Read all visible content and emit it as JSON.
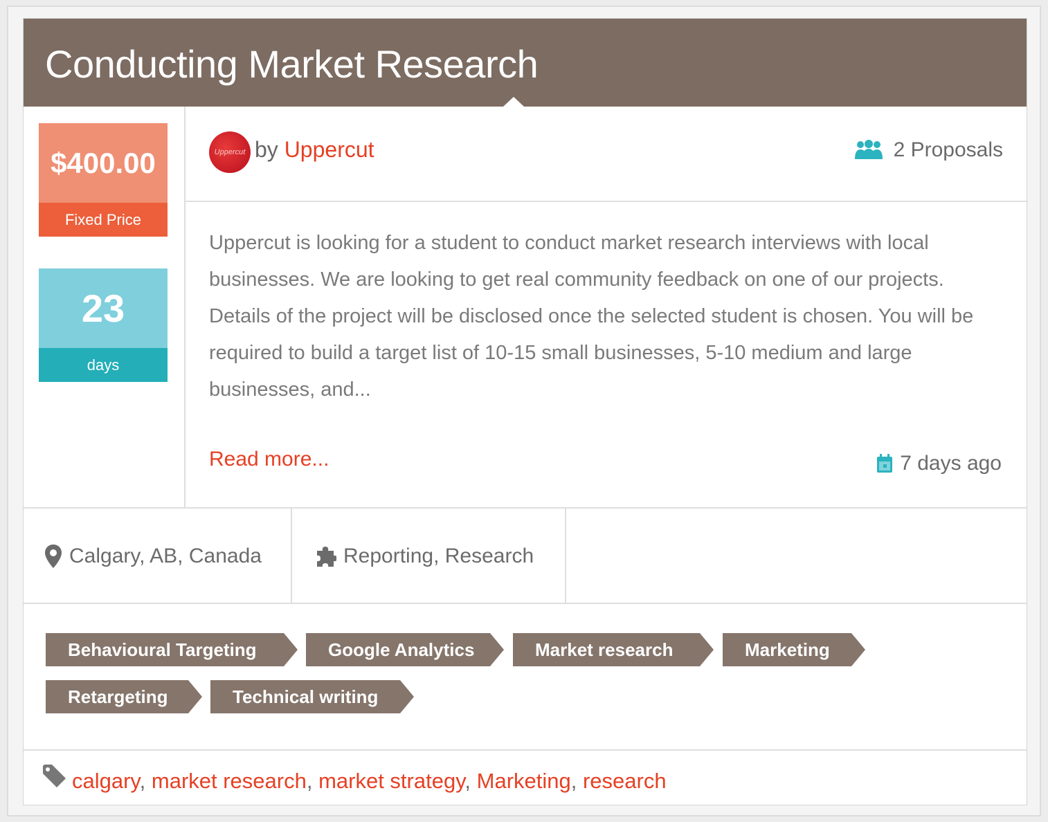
{
  "job": {
    "title": "Conducting Market Research",
    "price": "$400.00",
    "price_type": "Fixed Price",
    "days": "23",
    "days_label": "days",
    "author_prefix": "by ",
    "author_name": "Uppercut",
    "avatar_text": "Uppercut",
    "proposals": "2 Proposals",
    "description": "Uppercut is looking for a student to conduct market research interviews with local businesses. We are looking to get real community feedback on one of our projects. Details of the project will be disclosed once the selected student is chosen. You will be required to build a target list of 10-15 small businesses, 5-10 medium and large businesses, and...",
    "read_more": "Read more...",
    "posted": "7 days ago",
    "location": "Calgary, AB, Canada",
    "categories": "Reporting, Research"
  },
  "skills": [
    "Behavioural Targeting",
    "Google Analytics",
    "Market research",
    "Marketing",
    "Retargeting",
    "Technical writing"
  ],
  "tags": [
    "calgary",
    "market research",
    "market strategy",
    "Marketing",
    "research"
  ],
  "tags_separator": ", ",
  "icons": {
    "proposals": "users-icon",
    "date": "calendar-icon",
    "location": "map-pin-icon",
    "category": "puzzle-icon",
    "tags": "tag-icon"
  },
  "colors": {
    "title_bar": "#7d6c62",
    "price_top": "#ef8f74",
    "price_bottom": "#ec5f3a",
    "days_top": "#7fcfdd",
    "days_bottom": "#23aeb8",
    "link": "#e64024",
    "skill_bg": "#85756b"
  }
}
